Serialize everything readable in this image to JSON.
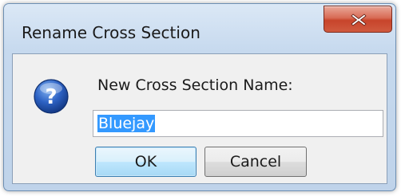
{
  "dialog": {
    "title": "Rename Cross Section",
    "close_icon": "close-icon",
    "question_icon": "question-icon",
    "prompt": "New Cross Section Name:",
    "name_value": "Bluejay",
    "ok_label": "OK",
    "cancel_label": "Cancel"
  },
  "colors": {
    "close_button": "#c7442b",
    "selection_highlight": "#3399ff",
    "ok_button_border": "#3c7fb1",
    "question_icon": "#1f4fa8"
  }
}
